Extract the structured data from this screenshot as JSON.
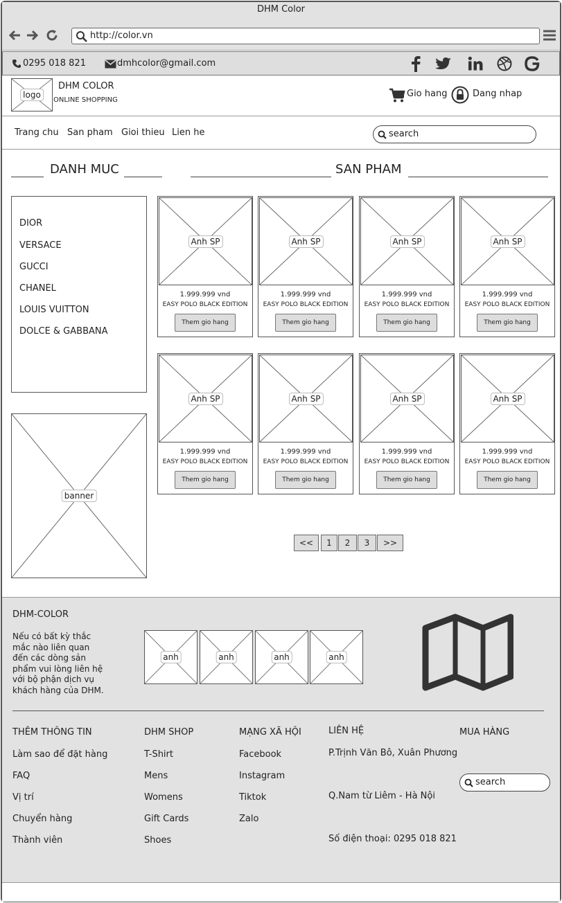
{
  "window": {
    "title": "DHM Color"
  },
  "browser": {
    "url": "http://color.vn"
  },
  "contact": {
    "phone": "0295 018 821",
    "email": "dmhcolor@gmail.com"
  },
  "header": {
    "logo": "logo",
    "brand": "DHM COLOR",
    "tagline": "ONLINE SHOPPING",
    "cart_label": "Gio hang",
    "login_label": "Dang nhap"
  },
  "menu": {
    "items": [
      "Trang chu",
      "San pham",
      "Gioi thieu",
      "Lien he"
    ],
    "search_placeholder": "search"
  },
  "sections": {
    "category_title": "DANH MUC",
    "product_title": "SAN PHAM"
  },
  "categories": [
    "DIOR",
    "VERSACE",
    "GUCCI",
    "CHANEL",
    "LOUIS VUITTON",
    "DOLCE & GABBANA"
  ],
  "banner": {
    "label": "banner"
  },
  "products": [
    {
      "image_label": "Anh SP",
      "price": "1.999.999 vnd",
      "name": "EASY POLO BLACK EDITION",
      "button": "Them gio  hang"
    },
    {
      "image_label": "Anh SP",
      "price": "1.999.999 vnd",
      "name": "EASY POLO BLACK EDITION",
      "button": "Them gio  hang"
    },
    {
      "image_label": "Anh SP",
      "price": "1.999.999 vnd",
      "name": "EASY POLO BLACK EDITION",
      "button": "Them gio  hang"
    },
    {
      "image_label": "Anh SP",
      "price": "1.999.999 vnd",
      "name": "EASY POLO BLACK EDITION",
      "button": "Them gio  hang"
    },
    {
      "image_label": "Anh SP",
      "price": "1.999.999 vnd",
      "name": "EASY POLO BLACK EDITION",
      "button": "Them gio  hang"
    },
    {
      "image_label": "Anh SP",
      "price": "1.999.999 vnd",
      "name": "EASY POLO BLACK EDITION",
      "button": "Them gio  hang"
    },
    {
      "image_label": "Anh SP",
      "price": "1.999.999 vnd",
      "name": "EASY POLO BLACK EDITION",
      "button": "Them gio  hang"
    },
    {
      "image_label": "Anh SP",
      "price": "1.999.999 vnd",
      "name": "EASY POLO BLACK EDITION",
      "button": "Them gio  hang"
    }
  ],
  "pagination": {
    "prev": "<<",
    "pages": [
      "1",
      "2",
      "3"
    ],
    "next": ">>"
  },
  "footer": {
    "brand": "DHM-COLOR",
    "description_lines": [
      "Nếu có bất kỳ thắc",
      "mắc nào liên quan",
      "đến các dòng sản",
      "phẩm vui lòng liên hệ",
      "với bộ phận dịch vụ",
      "khách hàng của DHM."
    ],
    "gallery": [
      "anh",
      "anh",
      "anh",
      "anh"
    ],
    "col1": {
      "title": "THÊM THÔNG TIN",
      "items": [
        "Làm sao để đặt hàng",
        "FAQ",
        "Vị trí",
        "Chuyển hàng",
        "Thành viên"
      ]
    },
    "col2": {
      "title": "DHM SHOP",
      "items": [
        "T-Shirt",
        "Mens",
        "Womens",
        "Gift Cards",
        "Shoes"
      ]
    },
    "col3": {
      "title": "MẠNG XÃ HỘI",
      "items": [
        "Facebook",
        "Instagram",
        "Tiktok",
        "Zalo"
      ]
    },
    "col4": {
      "title": "LIÊN HỆ",
      "address1": "P.Trịnh Văn Bô, Xuân Phương",
      "address2": "Q.Nam từ Liêm - Hà Nội",
      "phone": "Số điện thoại: 0295 018 821"
    },
    "col5": {
      "title": "MUA HÀNG",
      "search_placeholder": "search"
    }
  }
}
